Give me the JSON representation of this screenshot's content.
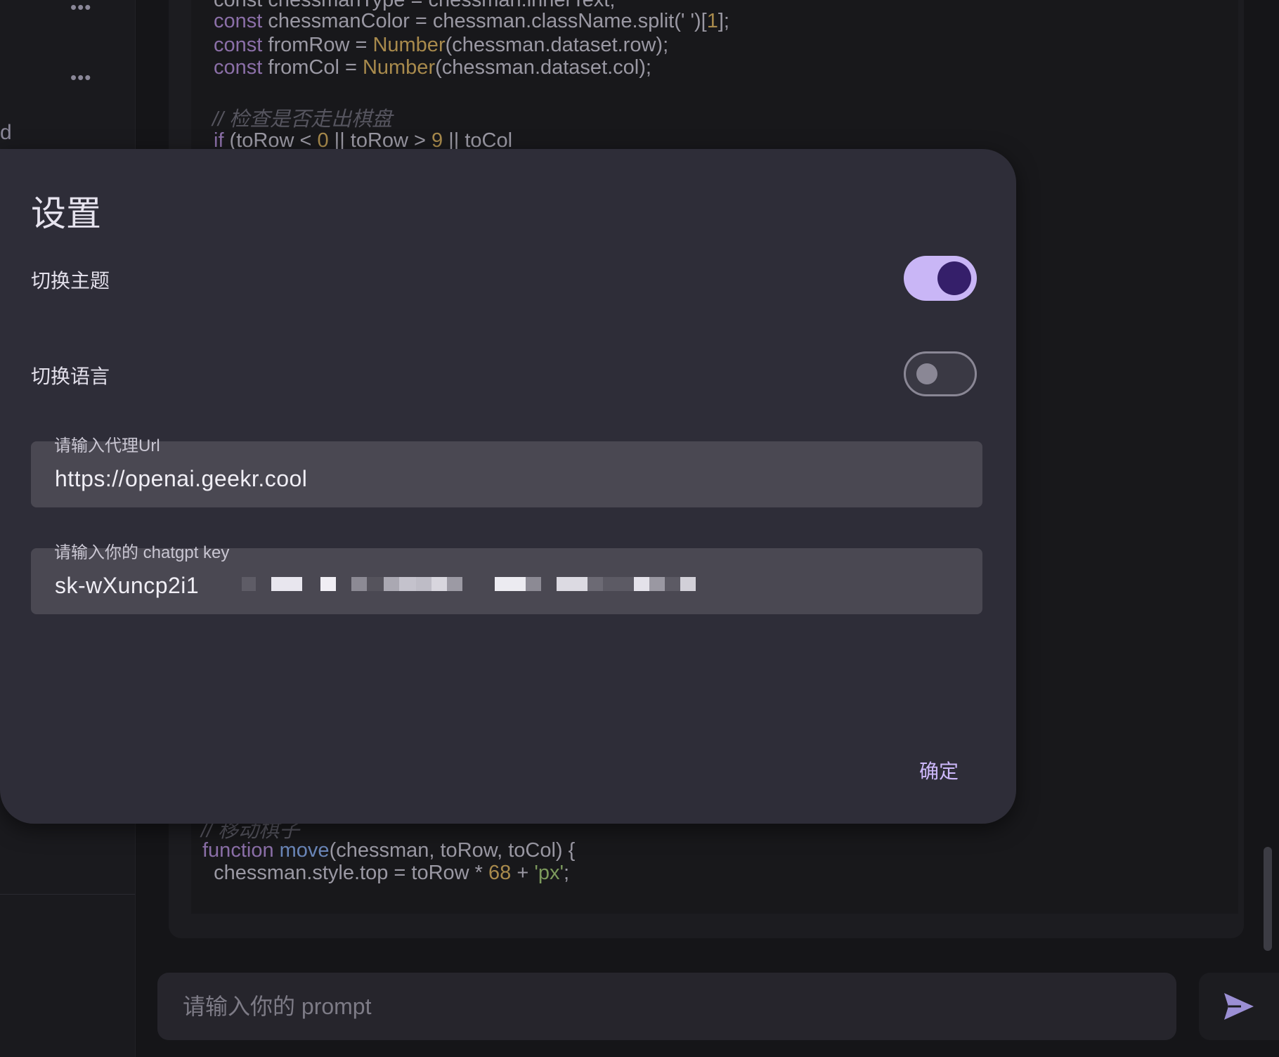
{
  "code": {
    "line1": "const chessmanType = chessman.innerText;",
    "line2_kw": "const",
    "line2_rest": " chessmanColor = chessman.className.split(' ')[",
    "line2_num": "1",
    "line2_end": "];",
    "line3_kw": "const",
    "line3_mid": " fromRow = ",
    "line3_fn": "Number",
    "line3_end": "(chessman.dataset.row);",
    "line4_kw": "const",
    "line4_mid": " fromCol = ",
    "line4_fn": "Number",
    "line4_end": "(chessman.dataset.col);",
    "comment1": "// 检查是否走出棋盘",
    "line6_kw": "if",
    "line6_a": " (toRow < ",
    "line6_n1": "0",
    "line6_b": " || toRow > ",
    "line6_n2": "9",
    "line6_c": " || toCol",
    "comment2": "// 移动棋子",
    "line8_kw": "function",
    "line8_fn": " move",
    "line8_end": "(chessman, toRow, toCol) {",
    "line9_a": "  chessman.style.top = toRow * ",
    "line9_n": "68",
    "line9_b": " + ",
    "line9_s": "'px'",
    "line9_c": ";"
  },
  "sidebar": {
    "more_glyph": "•••",
    "cut_letter": "d"
  },
  "modal": {
    "title": "设置",
    "theme_label": "切换主题",
    "language_label": "切换语言",
    "theme_on": true,
    "language_on": false,
    "proxy_label": "请输入代理Url",
    "proxy_value": "https://openai.geekr.cool",
    "key_label": "请输入你的 chatgpt key",
    "key_value": "sk-wXuncp2i1",
    "confirm_label": "确定"
  },
  "prompt": {
    "placeholder": "请输入你的 prompt"
  },
  "colors": {
    "accent": "#c9b6f6",
    "accent_dark": "#351f6a",
    "modal_bg": "#2e2d38",
    "field_bg": "#4a4852",
    "send_icon": "#9b8fd4"
  },
  "icons": {
    "send": "send-icon",
    "more": "more-icon"
  }
}
